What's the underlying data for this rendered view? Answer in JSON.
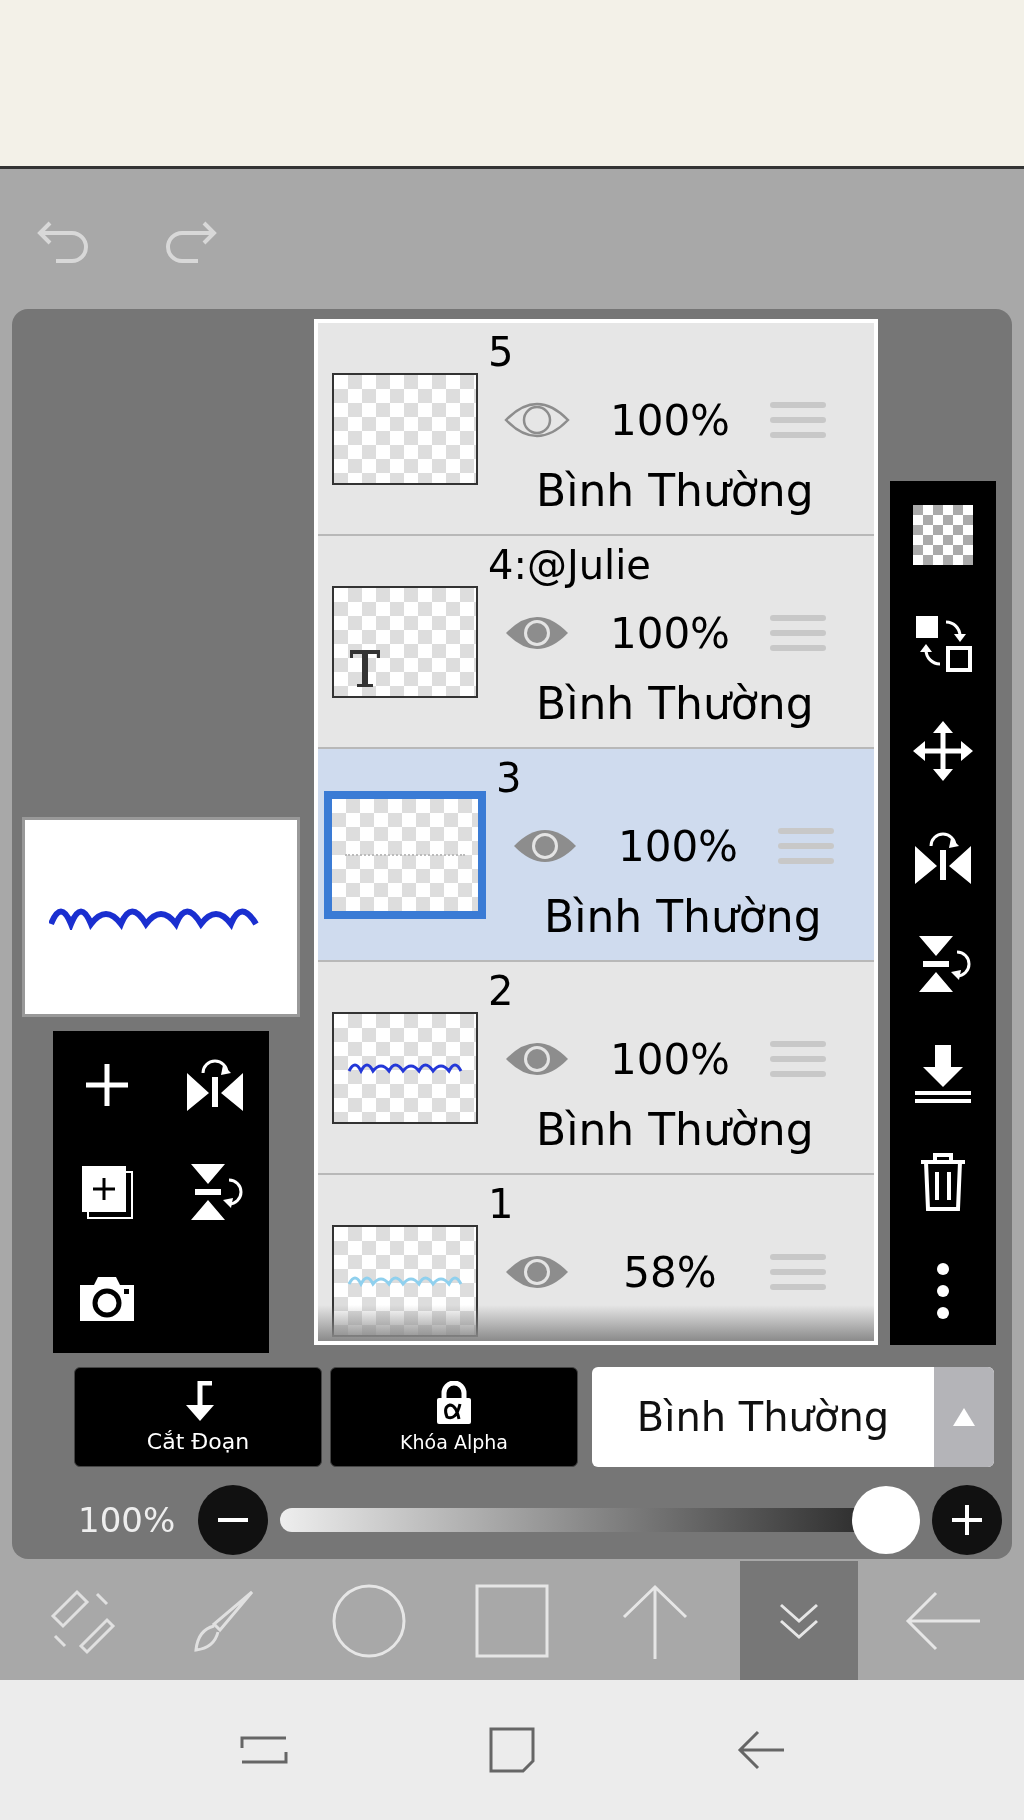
{
  "layers": [
    {
      "name": "5",
      "visible": false,
      "opacity": "100%",
      "blend": "Bình Thường",
      "kind": "blank",
      "selected": false
    },
    {
      "name": "4:@Julie",
      "visible": true,
      "opacity": "100%",
      "blend": "Bình Thường",
      "kind": "text",
      "selected": false
    },
    {
      "name": "3",
      "visible": true,
      "opacity": "100%",
      "blend": "Bình Thường",
      "kind": "line",
      "selected": true
    },
    {
      "name": "2",
      "visible": true,
      "opacity": "100%",
      "blend": "Bình Thường",
      "kind": "art",
      "selected": false
    },
    {
      "name": "1",
      "visible": true,
      "opacity": "58%",
      "kind": "art-faint",
      "selected": false
    }
  ],
  "buttons": [
    {
      "kind": "clipping",
      "label": "Cắt Đoạn"
    },
    {
      "kind": "alpha-lock",
      "label": "Khóa Alpha"
    }
  ],
  "blend_mode": {
    "value": "Bình Thường"
  },
  "opacity": {
    "reading": "100%",
    "level": 1.0
  },
  "bottom_tools": [
    {
      "kind": "transform",
      "selected": false
    },
    {
      "kind": "brush",
      "selected": false
    },
    {
      "kind": "circle",
      "selected": false
    },
    {
      "kind": "square",
      "selected": false
    },
    {
      "kind": "up",
      "selected": false
    },
    {
      "kind": "collapse",
      "selected": true
    },
    {
      "kind": "back",
      "selected": false
    }
  ]
}
